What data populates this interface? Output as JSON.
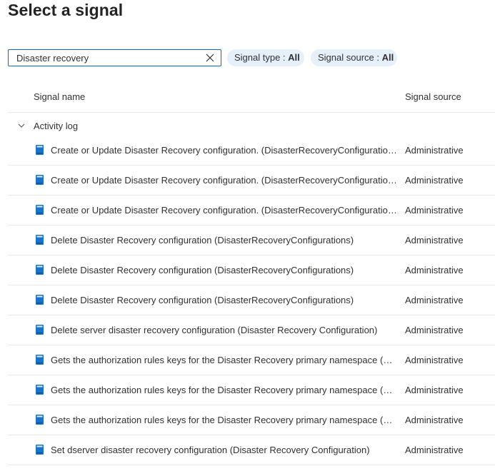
{
  "page": {
    "title": "Select a signal"
  },
  "search": {
    "value": "Disaster recovery"
  },
  "filters": {
    "signal_type": {
      "label": "Signal type : ",
      "value": "All"
    },
    "signal_source": {
      "label": "Signal source : ",
      "value": "All"
    }
  },
  "table": {
    "columns": {
      "name": "Signal name",
      "source": "Signal source"
    },
    "group": {
      "label": "Activity log",
      "expanded": true
    },
    "rows": [
      {
        "name": "Create or Update Disaster Recovery configuration. (DisasterRecoveryConfigurations)",
        "source": "Administrative"
      },
      {
        "name": "Create or Update Disaster Recovery configuration. (DisasterRecoveryConfigurations)",
        "source": "Administrative"
      },
      {
        "name": "Create or Update Disaster Recovery configuration. (DisasterRecoveryConfigurations)",
        "source": "Administrative"
      },
      {
        "name": "Delete Disaster Recovery configuration (DisasterRecoveryConfigurations)",
        "source": "Administrative"
      },
      {
        "name": "Delete Disaster Recovery configuration (DisasterRecoveryConfigurations)",
        "source": "Administrative"
      },
      {
        "name": "Delete Disaster Recovery configuration (DisasterRecoveryConfigurations)",
        "source": "Administrative"
      },
      {
        "name": "Delete server disaster recovery configuration (Disaster Recovery Configuration)",
        "source": "Administrative"
      },
      {
        "name": "Gets the authorization rules keys for the Disaster Recovery primary namespace (Aut...",
        "source": "Administrative"
      },
      {
        "name": "Gets the authorization rules keys for the Disaster Recovery primary namespace (Aut...",
        "source": "Administrative"
      },
      {
        "name": "Gets the authorization rules keys for the Disaster Recovery primary namespace (Aut...",
        "source": "Administrative"
      },
      {
        "name": "Set dserver disaster recovery configuration (Disaster Recovery Configuration)",
        "source": "Administrative"
      }
    ]
  },
  "icons": {
    "clear": "close-icon",
    "group_toggle": "chevron-down-icon",
    "row": "document-icon"
  },
  "colors": {
    "accent": "#0f6cbd",
    "pill_bg": "#e6f0fb",
    "icon_blue": "#1a73c9"
  }
}
